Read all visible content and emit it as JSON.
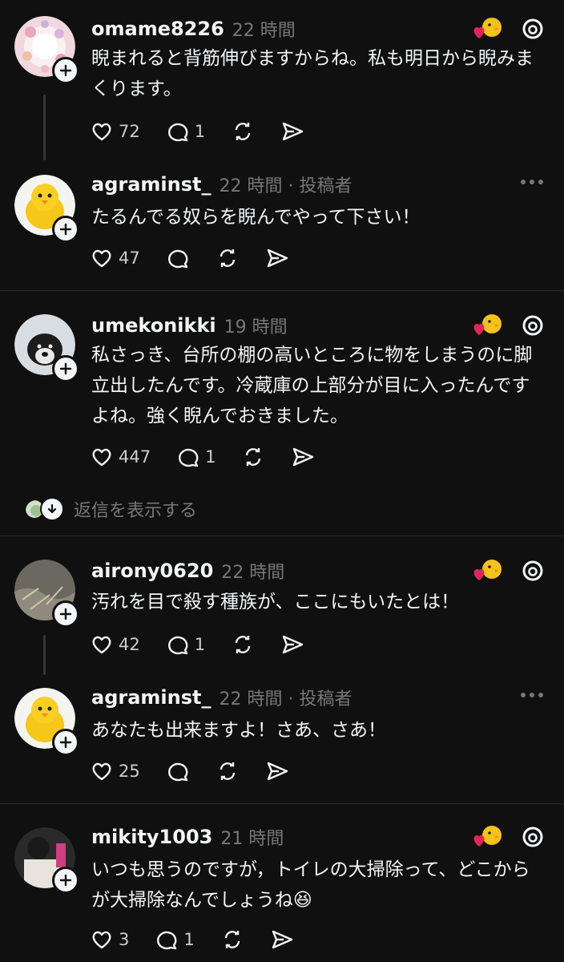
{
  "posts": [
    {
      "username": "omame8226",
      "meta": "22 時間",
      "text": "睨まれると背筋伸びますからね。私も明日から睨みまくります。",
      "likes": "72",
      "replies": "1",
      "kind": "threads"
    },
    {
      "username": "agraminst_",
      "meta": "22 時間 · 投稿者",
      "text": "たるんでる奴らを睨んでやって下さい！",
      "likes": "47",
      "replies": "",
      "kind": "author"
    },
    {
      "username": "umekonikki",
      "meta": "19 時間",
      "text": "私さっき、台所の棚の高いところに物をしまうのに脚立出したんです。冷蔵庫の上部分が目に入ったんですよね。強く睨んでおきました。",
      "likes": "447",
      "replies": "1",
      "kind": "threads"
    },
    {
      "username": "airony0620",
      "meta": "22 時間",
      "text": "汚れを目で殺す種族が、ここにもいたとは！",
      "likes": "42",
      "replies": "1",
      "kind": "threads"
    },
    {
      "username": "agraminst_",
      "meta": "22 時間 · 投稿者",
      "text": "あなたも出来ますよ！さあ、さあ！",
      "likes": "25",
      "replies": "",
      "kind": "author"
    },
    {
      "username": "mikity1003",
      "meta": "21 時間",
      "text": "いつも思うのですが，トイレの大掃除って、どこからが大掃除なんでしょうね😆",
      "likes": "3",
      "replies": "1",
      "kind": "threads"
    }
  ],
  "show_replies_label": "返信を表示する",
  "colors": {
    "background": "#101010",
    "text": "#f3f5f7",
    "muted": "#777777",
    "heart": "#e0245e"
  }
}
